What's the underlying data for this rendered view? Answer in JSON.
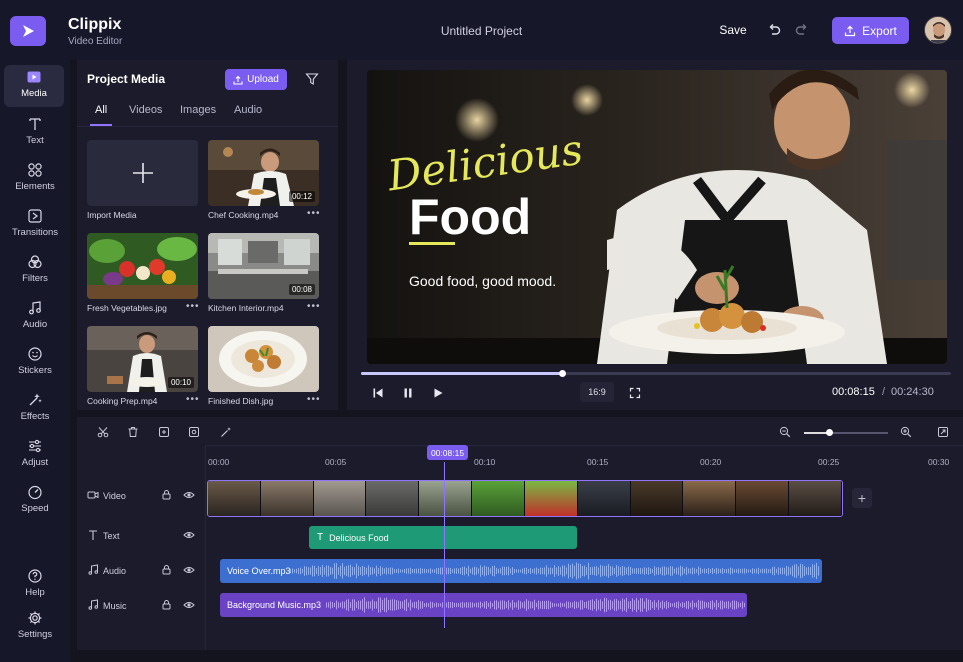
{
  "app": {
    "name": "Clippix",
    "subtitle": "Video Editor",
    "project_title": "Untitled Project"
  },
  "header": {
    "save_label": "Save",
    "export_label": "Export"
  },
  "nav": [
    {
      "label": "Media",
      "icon": "media-icon",
      "active": true
    },
    {
      "label": "Text",
      "icon": "text-icon"
    },
    {
      "label": "Elements",
      "icon": "elements-icon"
    },
    {
      "label": "Transitions",
      "icon": "transitions-icon"
    },
    {
      "label": "Filters",
      "icon": "filters-icon"
    },
    {
      "label": "Audio",
      "icon": "audio-icon"
    },
    {
      "label": "Stickers",
      "icon": "stickers-icon"
    },
    {
      "label": "Effects",
      "icon": "effects-icon"
    },
    {
      "label": "Adjust",
      "icon": "adjust-icon"
    },
    {
      "label": "Speed",
      "icon": "speed-icon"
    },
    {
      "label": "Help",
      "icon": "help-icon"
    },
    {
      "label": "Settings",
      "icon": "settings-icon"
    }
  ],
  "media_panel": {
    "title": "Project Media",
    "upload_label": "Upload",
    "tabs": [
      "All",
      "Videos",
      "Images",
      "Audio"
    ],
    "active_tab": "All",
    "items": [
      {
        "name": "Import Media"
      },
      {
        "name": "Chef Cooking.mp4",
        "duration": "00:12"
      },
      {
        "name": "Fresh Vegetables.jpg"
      },
      {
        "name": "Kitchen Interior.mp4",
        "duration": "00:08"
      },
      {
        "name": "Cooking Prep.mp4",
        "duration": "00:10"
      },
      {
        "name": "Finished Dish.jpg"
      }
    ],
    "more_label": "•••"
  },
  "preview": {
    "overlay_script": "Delicious",
    "overlay_title": "Food",
    "overlay_tagline": "Good food, good mood.",
    "progress": 0.34,
    "aspect_ratio": "16:9",
    "current_time": "00:08:15",
    "separator": "/",
    "total_time": "00:24:30"
  },
  "timeline": {
    "ticks": [
      "00:00",
      "00:05",
      "00:10",
      "00:15",
      "00:20",
      "00:25",
      "00:30"
    ],
    "playhead": "00:08:15",
    "zoom_level": 0.3,
    "tracks": [
      {
        "name": "Video"
      },
      {
        "name": "Text"
      },
      {
        "name": "Audio"
      },
      {
        "name": "Music"
      }
    ],
    "text_clip": "Delicious Food",
    "voice_clip": "Voice Over.mp3",
    "music_clip": "Background Music.mp3"
  },
  "colors": {
    "accent": "#7b5cf0",
    "text_clip": "#1f9a76",
    "voice_clip": "#3d6fd1",
    "music_clip": "#6a43c4",
    "overlay_yellow": "#e4e85a"
  }
}
